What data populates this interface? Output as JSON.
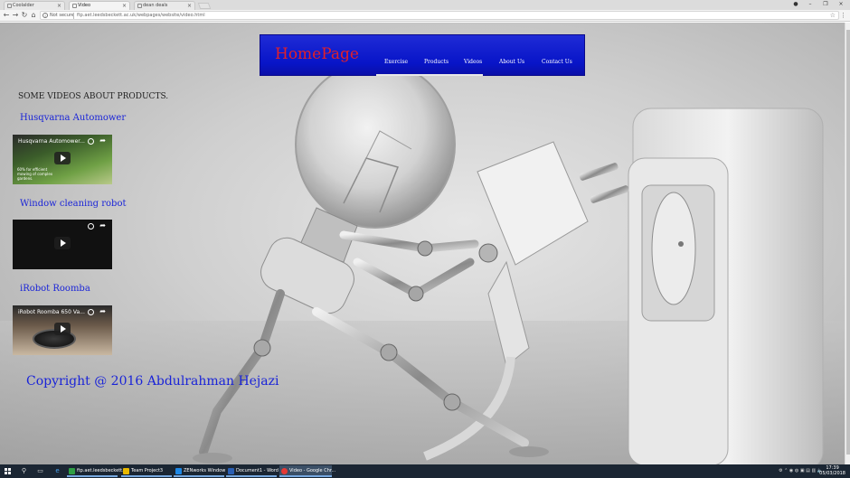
{
  "browser": {
    "tabs": [
      {
        "label": "Coolalder",
        "active": false
      },
      {
        "label": "Video",
        "active": true
      },
      {
        "label": "dean deals",
        "active": false
      }
    ],
    "address": {
      "security_label": "Not secure",
      "url": "ftp.aet.leedsbeckett.ac.uk/webpages/website/video.html"
    }
  },
  "site": {
    "nav": {
      "brand": "HomePage",
      "items": [
        "Exercise",
        "Products",
        "Videos",
        "About Us",
        "Contact Us"
      ],
      "active_item": "Videos"
    },
    "heading": "SOME VIDEOS ABOUT PRODUCTS.",
    "videos": [
      {
        "title": "Husqvarna Automower",
        "overlay": "Husqvarna Automower...",
        "caption": "60% for efficient mowing of complex gardens."
      },
      {
        "title": "Window cleaning robot",
        "overlay": ""
      },
      {
        "title": "iRobot Roomba",
        "overlay": "iRobot Roomba 650 Va..."
      }
    ],
    "copyright": "Copyright @ 2016 Abdulrahman Hejazi"
  },
  "taskbar": {
    "apps": [
      {
        "label": "ftp.aet.leedsbeckett...",
        "color": "#2f9e44"
      },
      {
        "label": "Team Project3",
        "color": "#e8b800"
      },
      {
        "label": "ZENworks Window",
        "color": "#1e88e5"
      },
      {
        "label": "Document1 - Word",
        "color": "#2b5fb3"
      },
      {
        "label": "Video - Google Chr...",
        "color": "#e53935",
        "active": true
      }
    ],
    "time": "17:39",
    "date": "05/03/2018"
  },
  "colors": {
    "nav_bg": "#0815c8",
    "brand": "#e0202a",
    "link": "#1a24d8"
  }
}
